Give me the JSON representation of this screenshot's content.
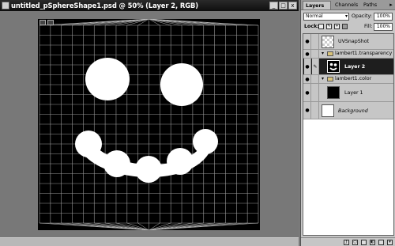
{
  "window": {
    "title": "untitled_pSphereShape1.psd @ 50% (Layer 2, RGB)",
    "min_label": "_",
    "max_label": "□",
    "close_label": "x"
  },
  "panel": {
    "tabs": [
      {
        "label": "Layers",
        "active": true
      },
      {
        "label": "Channels",
        "active": false
      },
      {
        "label": "Paths",
        "active": false
      }
    ],
    "menu_label": "▸",
    "blend_mode": "Normal",
    "opacity_label": "Opacity:",
    "opacity_value": "100%",
    "lock_label": "Lock:",
    "fill_label": "Fill:",
    "fill_value": "100%",
    "layers": [
      {
        "name": "UVSnapShot",
        "type": "layer"
      },
      {
        "name": "lambert1.transparency",
        "type": "group"
      },
      {
        "name": "Layer 2",
        "type": "layer",
        "selected": true
      },
      {
        "name": "lambert1.color",
        "type": "group"
      },
      {
        "name": "Layer 1",
        "type": "layer"
      },
      {
        "name": "Background",
        "type": "layer"
      }
    ]
  },
  "icons": [
    "document-icon",
    "eye-icon",
    "brush-link-icon",
    "folder-icon",
    "triangle-down-icon",
    "lock-transparency-icon",
    "lock-paint-icon",
    "lock-move-icon",
    "lock-all-icon",
    "layer-style-icon",
    "mask-icon",
    "new-set-icon",
    "adjustment-icon",
    "new-layer-icon",
    "trash-icon"
  ]
}
